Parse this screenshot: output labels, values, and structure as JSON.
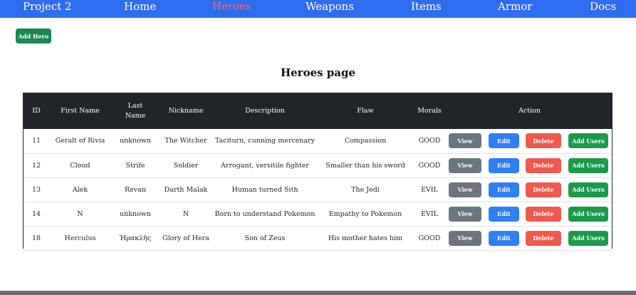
{
  "nav": {
    "brand": "Project 2",
    "links": [
      "Home",
      "Heroes",
      "Weapons",
      "Items",
      "Armor",
      "Docs"
    ],
    "active": "Heroes"
  },
  "add_hero_label": "Add Hero",
  "page_title": "Heroes page",
  "table": {
    "headers": [
      "ID",
      "First Name",
      "Last Name",
      "Nickname",
      "Description",
      "Flaw",
      "Morals",
      "Action"
    ],
    "rows": [
      {
        "id": "11",
        "first": "Geralt of Rivia",
        "last": "unknown",
        "nickname": "The Witcher",
        "description": "Taciturn, cunning mercenary",
        "flaw": "Compassion",
        "morals": "GOOD"
      },
      {
        "id": "12",
        "first": "Cloud",
        "last": "Strife",
        "nickname": "Soldier",
        "description": "Arrogant, versitile fighter",
        "flaw": "Smaller than his sword",
        "morals": "GOOD"
      },
      {
        "id": "13",
        "first": "Alek",
        "last": "Revan",
        "nickname": "Darth Malak",
        "description": "Human turned Sith",
        "flaw": "The Jedi",
        "morals": "EVIL"
      },
      {
        "id": "14",
        "first": "N",
        "last": "unknown",
        "nickname": "N",
        "description": "Born to understand Pokemon",
        "flaw": "Empathy to Pokemon",
        "morals": "EVIL"
      },
      {
        "id": "18",
        "first": "Herculus",
        "last": "Ἡρακλῆς",
        "nickname": "Glory of Hera",
        "description": "Son of Zeus",
        "flaw": "His mother hates him",
        "morals": "GOOD"
      }
    ],
    "action_labels": {
      "view": "View",
      "edit": "Edit",
      "delete": "Delete",
      "add_users": "Add Users"
    }
  },
  "colors": {
    "navbar": "#2e6cf0",
    "nav_active": "#f06a68",
    "header_bg": "#212529",
    "view": "#6c757d",
    "edit": "#2f7ff5",
    "delete": "#ef5a4e",
    "add": "#1c9a4b"
  }
}
